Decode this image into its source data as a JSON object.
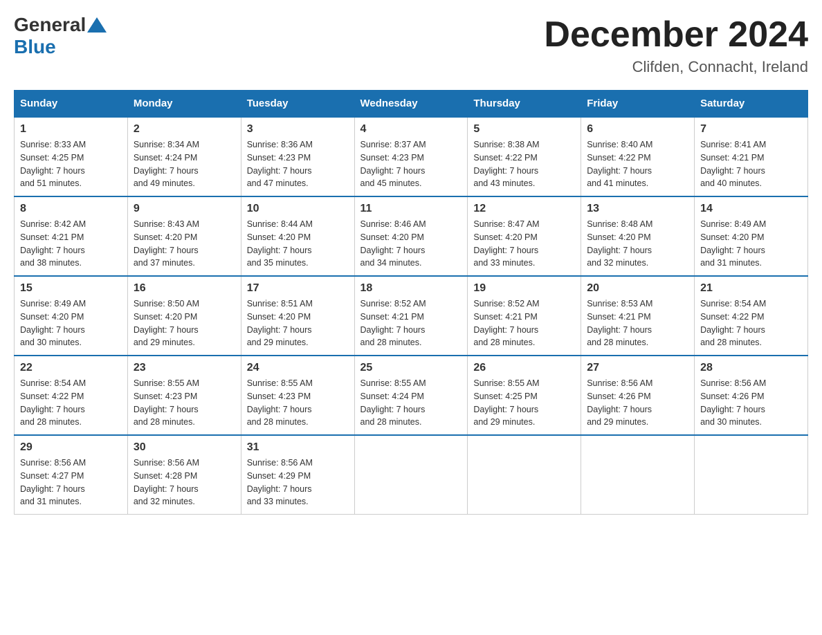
{
  "header": {
    "logo_general": "General",
    "logo_blue": "Blue",
    "month_title": "December 2024",
    "location": "Clifden, Connacht, Ireland"
  },
  "days_of_week": [
    "Sunday",
    "Monday",
    "Tuesday",
    "Wednesday",
    "Thursday",
    "Friday",
    "Saturday"
  ],
  "weeks": [
    [
      {
        "day": "1",
        "sunrise": "8:33 AM",
        "sunset": "4:25 PM",
        "daylight": "7 hours and 51 minutes."
      },
      {
        "day": "2",
        "sunrise": "8:34 AM",
        "sunset": "4:24 PM",
        "daylight": "7 hours and 49 minutes."
      },
      {
        "day": "3",
        "sunrise": "8:36 AM",
        "sunset": "4:23 PM",
        "daylight": "7 hours and 47 minutes."
      },
      {
        "day": "4",
        "sunrise": "8:37 AM",
        "sunset": "4:23 PM",
        "daylight": "7 hours and 45 minutes."
      },
      {
        "day": "5",
        "sunrise": "8:38 AM",
        "sunset": "4:22 PM",
        "daylight": "7 hours and 43 minutes."
      },
      {
        "day": "6",
        "sunrise": "8:40 AM",
        "sunset": "4:22 PM",
        "daylight": "7 hours and 41 minutes."
      },
      {
        "day": "7",
        "sunrise": "8:41 AM",
        "sunset": "4:21 PM",
        "daylight": "7 hours and 40 minutes."
      }
    ],
    [
      {
        "day": "8",
        "sunrise": "8:42 AM",
        "sunset": "4:21 PM",
        "daylight": "7 hours and 38 minutes."
      },
      {
        "day": "9",
        "sunrise": "8:43 AM",
        "sunset": "4:20 PM",
        "daylight": "7 hours and 37 minutes."
      },
      {
        "day": "10",
        "sunrise": "8:44 AM",
        "sunset": "4:20 PM",
        "daylight": "7 hours and 35 minutes."
      },
      {
        "day": "11",
        "sunrise": "8:46 AM",
        "sunset": "4:20 PM",
        "daylight": "7 hours and 34 minutes."
      },
      {
        "day": "12",
        "sunrise": "8:47 AM",
        "sunset": "4:20 PM",
        "daylight": "7 hours and 33 minutes."
      },
      {
        "day": "13",
        "sunrise": "8:48 AM",
        "sunset": "4:20 PM",
        "daylight": "7 hours and 32 minutes."
      },
      {
        "day": "14",
        "sunrise": "8:49 AM",
        "sunset": "4:20 PM",
        "daylight": "7 hours and 31 minutes."
      }
    ],
    [
      {
        "day": "15",
        "sunrise": "8:49 AM",
        "sunset": "4:20 PM",
        "daylight": "7 hours and 30 minutes."
      },
      {
        "day": "16",
        "sunrise": "8:50 AM",
        "sunset": "4:20 PM",
        "daylight": "7 hours and 29 minutes."
      },
      {
        "day": "17",
        "sunrise": "8:51 AM",
        "sunset": "4:20 PM",
        "daylight": "7 hours and 29 minutes."
      },
      {
        "day": "18",
        "sunrise": "8:52 AM",
        "sunset": "4:21 PM",
        "daylight": "7 hours and 28 minutes."
      },
      {
        "day": "19",
        "sunrise": "8:52 AM",
        "sunset": "4:21 PM",
        "daylight": "7 hours and 28 minutes."
      },
      {
        "day": "20",
        "sunrise": "8:53 AM",
        "sunset": "4:21 PM",
        "daylight": "7 hours and 28 minutes."
      },
      {
        "day": "21",
        "sunrise": "8:54 AM",
        "sunset": "4:22 PM",
        "daylight": "7 hours and 28 minutes."
      }
    ],
    [
      {
        "day": "22",
        "sunrise": "8:54 AM",
        "sunset": "4:22 PM",
        "daylight": "7 hours and 28 minutes."
      },
      {
        "day": "23",
        "sunrise": "8:55 AM",
        "sunset": "4:23 PM",
        "daylight": "7 hours and 28 minutes."
      },
      {
        "day": "24",
        "sunrise": "8:55 AM",
        "sunset": "4:23 PM",
        "daylight": "7 hours and 28 minutes."
      },
      {
        "day": "25",
        "sunrise": "8:55 AM",
        "sunset": "4:24 PM",
        "daylight": "7 hours and 28 minutes."
      },
      {
        "day": "26",
        "sunrise": "8:55 AM",
        "sunset": "4:25 PM",
        "daylight": "7 hours and 29 minutes."
      },
      {
        "day": "27",
        "sunrise": "8:56 AM",
        "sunset": "4:26 PM",
        "daylight": "7 hours and 29 minutes."
      },
      {
        "day": "28",
        "sunrise": "8:56 AM",
        "sunset": "4:26 PM",
        "daylight": "7 hours and 30 minutes."
      }
    ],
    [
      {
        "day": "29",
        "sunrise": "8:56 AM",
        "sunset": "4:27 PM",
        "daylight": "7 hours and 31 minutes."
      },
      {
        "day": "30",
        "sunrise": "8:56 AM",
        "sunset": "4:28 PM",
        "daylight": "7 hours and 32 minutes."
      },
      {
        "day": "31",
        "sunrise": "8:56 AM",
        "sunset": "4:29 PM",
        "daylight": "7 hours and 33 minutes."
      },
      null,
      null,
      null,
      null
    ]
  ],
  "labels": {
    "sunrise": "Sunrise:",
    "sunset": "Sunset:",
    "daylight": "Daylight:"
  }
}
